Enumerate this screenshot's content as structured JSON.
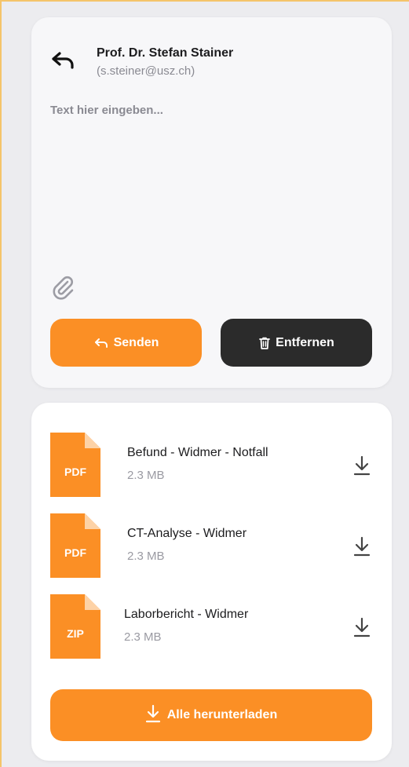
{
  "compose": {
    "sender_name": "Prof. Dr. Stefan Stainer",
    "sender_email": "(s.steiner@usz.ch)",
    "message_value": "",
    "message_placeholder": "Text hier eingeben...",
    "send_label": "Senden",
    "remove_label": "Entfernen"
  },
  "files": {
    "items": [
      {
        "ext": "PDF",
        "name": "Befund - Widmer - Notfall",
        "size": "2.3 MB"
      },
      {
        "ext": "PDF",
        "name": "CT-Analyse - Widmer",
        "size": "2.3 MB"
      },
      {
        "ext": "ZIP",
        "name": "Laborbericht - Widmer",
        "size": "2.3 MB"
      }
    ],
    "download_all_label": "Alle herunterladen"
  },
  "icons": {
    "reply": "reply-arrow-icon",
    "attach": "paperclip-icon",
    "send": "reply-arrow-icon",
    "remove": "trash-icon",
    "download": "download-icon",
    "file": "document-icon"
  },
  "colors": {
    "accent": "#fb8f25",
    "dark_button": "#2b2b2b",
    "background": "#ececef",
    "frame_border": "#f5c46a"
  }
}
